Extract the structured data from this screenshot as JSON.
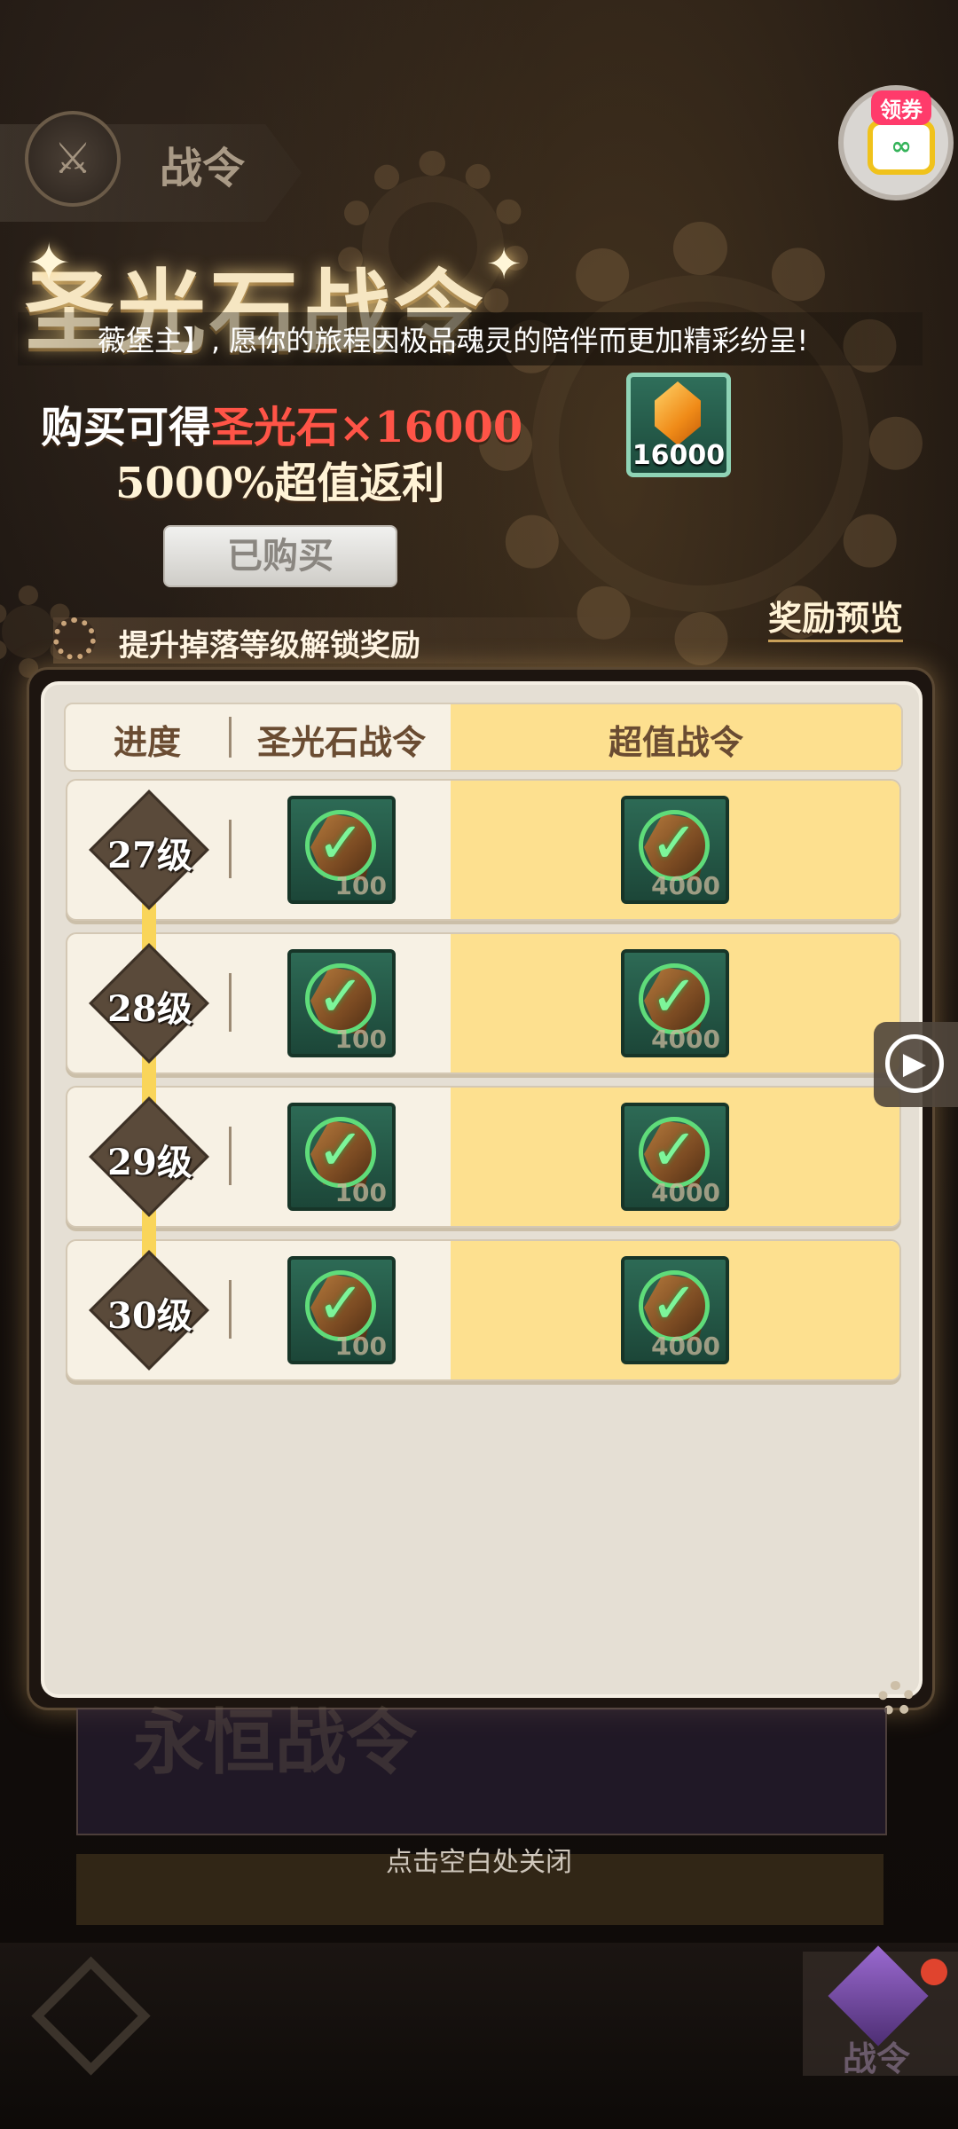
{
  "top_tab": {
    "title": "战令"
  },
  "coupon": {
    "label": "领券"
  },
  "banner": {
    "title": "圣光石战令",
    "marquee": "薇堡主】, 愿你的旅程因极品魂灵的陪伴而更加精彩纷呈!",
    "buy_prefix": "购买可得",
    "buy_item": "圣光石",
    "buy_times": "×16000",
    "rebate": "5000%超值返利",
    "gem_count": "16000",
    "purchased_label": "已购买",
    "preview_label": "奖励预览",
    "hint": "提升掉落等级解锁奖励"
  },
  "table": {
    "headers": {
      "progress": "进度",
      "basic": "圣光石战令",
      "premium": "超值战令"
    },
    "rows": [
      {
        "level": "27级",
        "basic_amount": "100",
        "premium_amount": "4000"
      },
      {
        "level": "28级",
        "basic_amount": "100",
        "premium_amount": "4000"
      },
      {
        "level": "29级",
        "basic_amount": "100",
        "premium_amount": "4000"
      },
      {
        "level": "30级",
        "basic_amount": "100",
        "premium_amount": "4000"
      }
    ]
  },
  "footer": {
    "close_hint": "点击空白处关闭",
    "ghost_text": "永恒战令",
    "nav_right_label": "战令"
  },
  "icons": {
    "claimed": "check-icon",
    "reward_item": "ore-icon",
    "coupon": "game-controller-icon",
    "side_button": "play-icon"
  },
  "colors": {
    "premium_column": "#fde08f",
    "level_track": "#f9d55a",
    "check_green": "#5fdc7a",
    "price_red": "#ff5447"
  }
}
